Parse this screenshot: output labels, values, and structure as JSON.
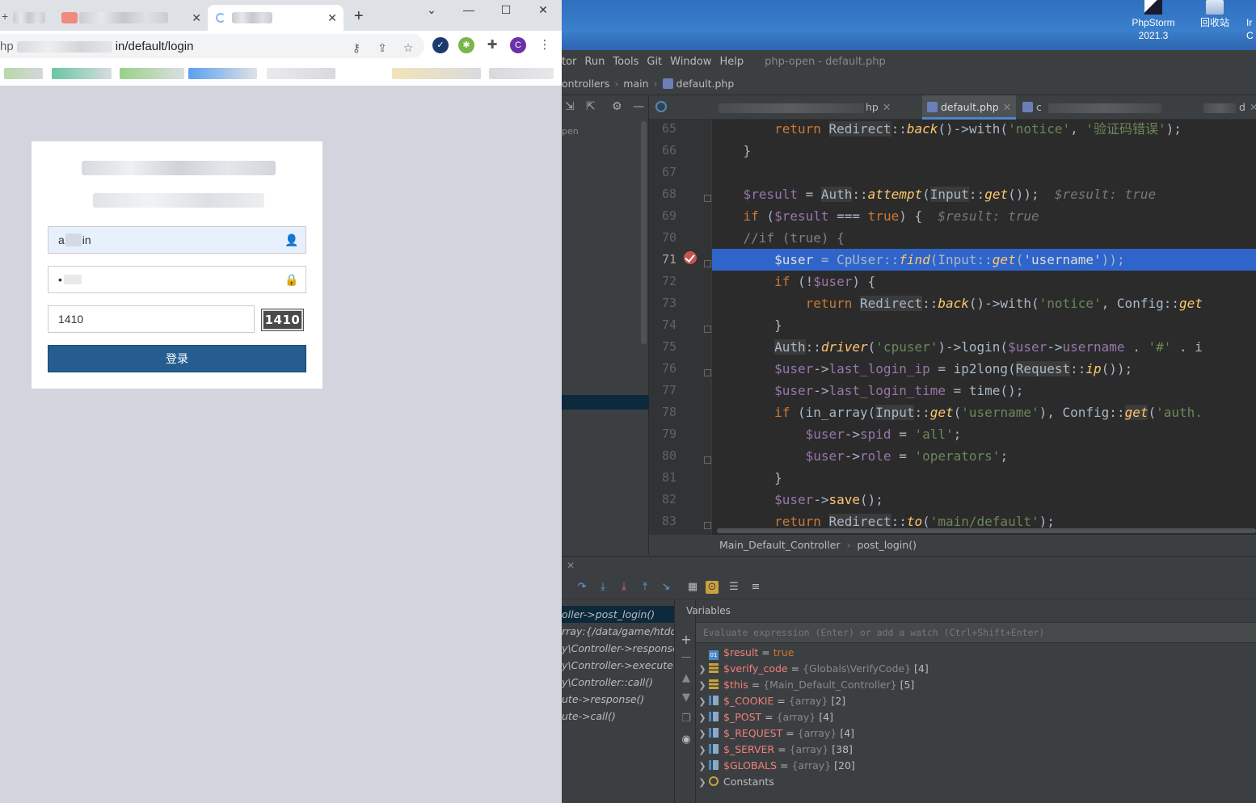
{
  "browser": {
    "tabs": [
      {
        "label": "",
        "close": "✕",
        "active": false
      },
      {
        "label": "",
        "close": "✕",
        "active": true
      }
    ],
    "new_tab": "+",
    "url_prefix": "hp",
    "url_visible": "in/default/login",
    "window_controls": {
      "menu": "⌄",
      "minimize": "—",
      "maximize": "☐",
      "close": "✕"
    },
    "profile_initial": "C"
  },
  "login": {
    "username_visible": "in",
    "username_prefix": "a",
    "password_visible": "•",
    "captcha_value": "1410",
    "captcha_image_text": "1410",
    "submit_label": "登录"
  },
  "desktop": {
    "icons": [
      {
        "label": "PhpStorm\n2021.3"
      },
      {
        "label": "回收站"
      },
      {
        "label": "Ir\nC"
      }
    ]
  },
  "ide": {
    "menu": [
      "tor",
      "Run",
      "Tools",
      "Git",
      "Window",
      "Help"
    ],
    "project_title": "php-open - default.php",
    "nav": [
      "ontrollers",
      "main",
      "default.php"
    ],
    "project_label": "pen",
    "tabs": [
      {
        "label": "hp",
        "close": "✕"
      },
      {
        "label": "default.php",
        "close": "✕",
        "active": true
      },
      {
        "label": "c",
        "close": ""
      },
      {
        "label": "d",
        "close": "✕"
      }
    ],
    "line_numbers": [
      "65",
      "66",
      "67",
      "68",
      "69",
      "70",
      "71",
      "72",
      "73",
      "74",
      "75",
      "76",
      "77",
      "78",
      "79",
      "80",
      "81",
      "82",
      "83"
    ],
    "current_line": "71",
    "breadcrumb": [
      "Main_Default_Controller",
      "post_login()"
    ],
    "colors": {
      "keyword": "#cc7832",
      "variable": "#9876aa",
      "string": "#6a8759",
      "function": "#ffc66d",
      "highlight": "#2f65ca"
    }
  },
  "debug": {
    "variables_label": "Variables",
    "eval_placeholder": "Evaluate expression (Enter) or add a watch (Ctrl+Shift+Enter)",
    "frames": [
      "oller->post_login()",
      "rray:{/data/game/htdoc",
      "y\\Controller->response()",
      "y\\Controller->execute()",
      "y\\Controller::call()",
      "ute->response()",
      "ute->call()"
    ],
    "vars": [
      {
        "name": "$result",
        "eq": " = ",
        "type": "",
        "value": "true",
        "count": "",
        "icon": "prim",
        "expand": false
      },
      {
        "name": "$verify_code",
        "eq": " = ",
        "type": "{Globals\\VerifyCode}",
        "value": "",
        "count": " [4]",
        "icon": "obj",
        "expand": true
      },
      {
        "name": "$this",
        "eq": " = ",
        "type": "{Main_Default_Controller}",
        "value": "",
        "count": " [5]",
        "icon": "obj",
        "expand": true
      },
      {
        "name": "$_COOKIE",
        "eq": " = ",
        "type": "{array}",
        "value": "",
        "count": " [2]",
        "icon": "arr",
        "expand": true
      },
      {
        "name": "$_POST",
        "eq": " = ",
        "type": "{array}",
        "value": "",
        "count": " [4]",
        "icon": "arr",
        "expand": true
      },
      {
        "name": "$_REQUEST",
        "eq": " = ",
        "type": "{array}",
        "value": "",
        "count": " [4]",
        "icon": "arr",
        "expand": true
      },
      {
        "name": "$_SERVER",
        "eq": " = ",
        "type": "{array}",
        "value": "",
        "count": " [38]",
        "icon": "arr",
        "expand": true
      },
      {
        "name": "$GLOBALS",
        "eq": " = ",
        "type": "{array}",
        "value": "",
        "count": " [20]",
        "icon": "arr",
        "expand": true
      },
      {
        "name": "Constants",
        "eq": "",
        "type": "",
        "value": "",
        "count": "",
        "icon": "const",
        "expand": true
      }
    ]
  }
}
